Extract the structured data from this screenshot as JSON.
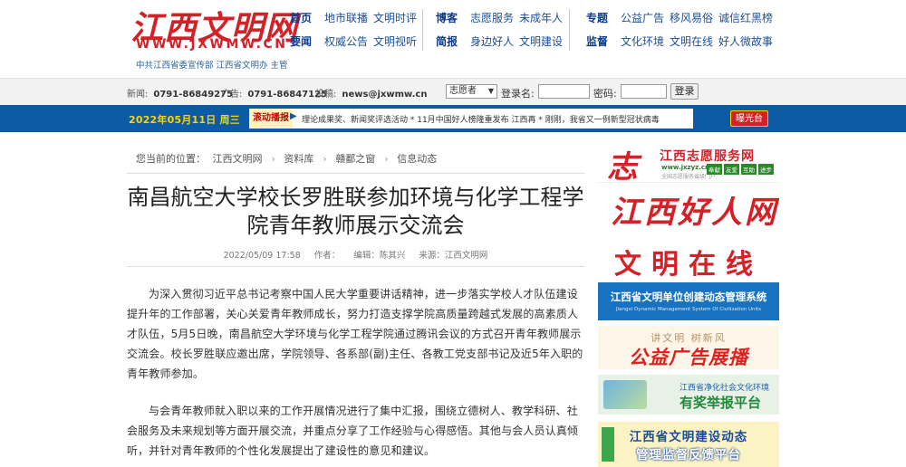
{
  "header": {
    "logo_text": "江西文明网",
    "logo_domain": "WWW.JXWMW.CN",
    "logo_sub": "中共江西省委宣传部  江西省文明办 主管",
    "nav_groups": [
      {
        "rows": [
          {
            "head": "首页",
            "links": [
              "地市联播",
              "文明时评"
            ]
          },
          {
            "head": "要闻",
            "links": [
              "权威公告",
              "文明视听"
            ]
          }
        ]
      },
      {
        "rows": [
          {
            "head": "博客",
            "links": [
              "志愿服务",
              "未成年人"
            ]
          },
          {
            "head": "简报",
            "links": [
              "身边好人",
              "文明建设"
            ]
          }
        ]
      },
      {
        "rows": [
          {
            "head": "专题",
            "links": [
              "公益广告",
              "移风易俗",
              "诚信红黑榜"
            ]
          },
          {
            "head": "监督",
            "links": [
              "文化环境",
              "文明在线",
              "好人微故事"
            ]
          }
        ]
      }
    ]
  },
  "infobar": {
    "news_label": "新闻:",
    "news_phone": "0791-86849275",
    "ad_label": "广告:",
    "ad_phone": "0791-86847125",
    "email_label": "投稿:",
    "email": "news@jxwmw.cn",
    "select_value": "志愿者",
    "login_label": "登录名:",
    "password_label": "密码:",
    "login_button": "登录"
  },
  "band": {
    "date": "2022年05月11日 周三",
    "ticker_label": "滚动播报",
    "ticker_text": "理论成果奖、新闻奖评选活动 * 11月中国好人榜隆重发布 江西再 * 刚刚，我省又一例新型冠状病毒",
    "redlight": "曝光台"
  },
  "breadcrumb": {
    "prefix": "您当前的位置：",
    "items": [
      "江西文明网",
      "资料库",
      "赣鄱之窗",
      "信息动态"
    ]
  },
  "article": {
    "title": "南昌航空大学校长罗胜联参加环境与化学工程学院青年教师展示交流会",
    "datetime": "2022/05/09 17:58",
    "author": "作者：",
    "editor": "编辑：陈其兴",
    "source": "来源：江西文明网",
    "paragraphs": [
      "为深入贯彻习近平总书记考察中国人民大学重要讲话精神，进一步落实学校人才队伍建设提升年的工作部署，关心关爱青年教师成长，努力打造支撑学院高质量跨越式发展的高素质人才队伍，5月5日晚，南昌航空大学环境与化学工程学院通过腾讯会议的方式召开青年教师展示交流会。校长罗胜联应邀出席，学院领导、各系部(副)主任、各教工党支部书记及近5年入职的青年教师参加。",
      "与会青年教师就入职以来的工作开展情况进行了集中汇报，围绕立德树人、教学科研、社会服务及未来规划等方面开展交流，并重点分享了工作经验与心得感悟。其他与会人员认真倾听，并针对青年教师的个性化发展提出了建设性的意见和建议。"
    ]
  },
  "sidebar": {
    "b1": {
      "mark": "志",
      "title": "江西志愿服务网",
      "domain": "www.jxzyz.cn",
      "sub": "全国志愿服务省级门户",
      "tags": [
        "奉献",
        "友爱",
        "互助",
        "进步"
      ]
    },
    "b2": {
      "title": "江西好人网"
    },
    "b3": {
      "title": "文明在线"
    },
    "b4": {
      "title": "江西省文明单位创建动态管理系统",
      "sub": "Jiangxi Dynamic Management System Of Civilization Units"
    },
    "b5": {
      "sub": "讲文明  树新风",
      "title": "公益广告展播"
    },
    "b6": {
      "sub": "江西省净化社会文化环境",
      "title": "有奖举报平台"
    },
    "b7": {
      "line1": "江西省文明建设动态",
      "line2": "管理监督反馈平台"
    }
  }
}
